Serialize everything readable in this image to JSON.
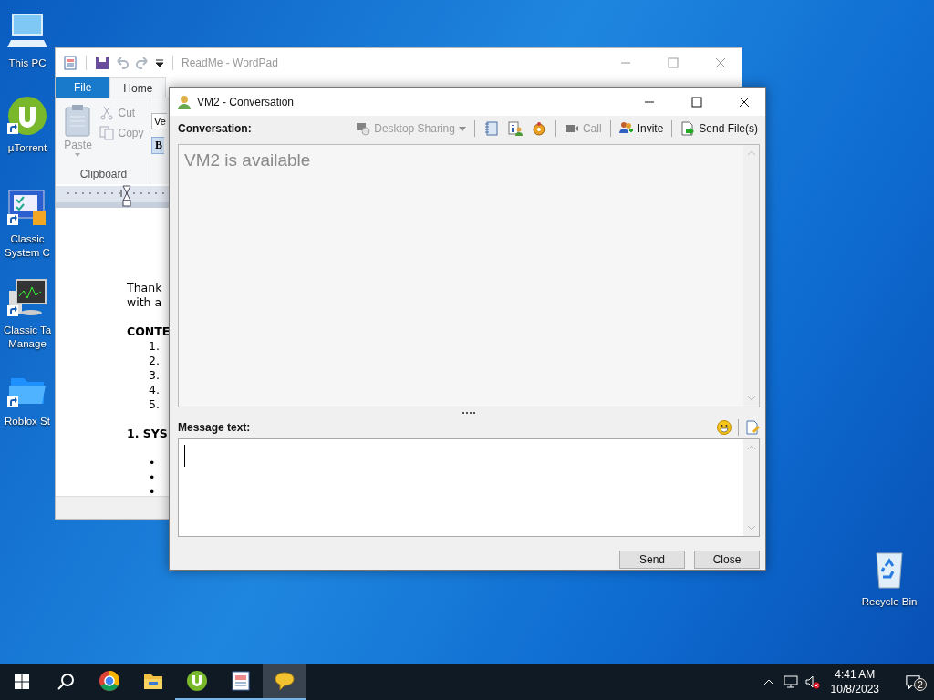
{
  "desktop": {
    "icons": [
      {
        "lines": [
          "This PC"
        ]
      },
      {
        "lines": [
          "µTorrent"
        ]
      },
      {
        "lines": [
          "Classic",
          "System C"
        ]
      },
      {
        "lines": [
          "Classic Ta",
          "Manage"
        ]
      },
      {
        "lines": [
          "Roblox St"
        ]
      }
    ],
    "recycle_bin": {
      "lines": [
        "Recycle Bin"
      ]
    }
  },
  "wordpad": {
    "title": "ReadMe - WordPad",
    "active": false,
    "tabs": [
      {
        "label": "File",
        "kind": "file",
        "selected": false
      },
      {
        "label": "Home",
        "kind": "tab",
        "selected": true
      }
    ],
    "clipboard": {
      "paste": "Paste",
      "cut": "Cut",
      "copy": "Copy",
      "disabled": true,
      "group": "Clipboard"
    },
    "font_field": "Ve",
    "bold_button": "B",
    "lines": [
      {
        "kind": "text",
        "text": "Thank"
      },
      {
        "kind": "text",
        "text": "with a"
      },
      {
        "kind": "blank"
      },
      {
        "kind": "heading",
        "text": "CONTE"
      },
      {
        "kind": "item",
        "text": "1."
      },
      {
        "kind": "item",
        "text": "2."
      },
      {
        "kind": "item",
        "text": "3."
      },
      {
        "kind": "item",
        "text": "4."
      },
      {
        "kind": "item",
        "text": "5."
      },
      {
        "kind": "blank"
      },
      {
        "kind": "heading",
        "text": "1. SYS"
      },
      {
        "kind": "blank"
      },
      {
        "kind": "item",
        "text": "•"
      },
      {
        "kind": "item",
        "text": "•"
      },
      {
        "kind": "item",
        "text": "•"
      }
    ]
  },
  "conversation": {
    "title": "VM2 - Conversation",
    "active": true,
    "label": "Conversation:",
    "toolbar": [
      {
        "kind": "labeled",
        "label": "Desktop Sharing",
        "disabled": true,
        "dropdown": true
      },
      {
        "kind": "separator"
      },
      {
        "kind": "icon"
      },
      {
        "kind": "icon"
      },
      {
        "kind": "icon"
      },
      {
        "kind": "separator"
      },
      {
        "kind": "labeled",
        "label": "Call",
        "disabled": true,
        "dropdown": false
      },
      {
        "kind": "separator"
      },
      {
        "kind": "labeled",
        "label": "Invite",
        "disabled": false,
        "dropdown": false
      },
      {
        "kind": "separator"
      },
      {
        "kind": "labeled",
        "label": "Send File(s)",
        "disabled": false,
        "dropdown": false
      }
    ],
    "status_text": "VM2 is available",
    "message_label": "Message text:",
    "buttons": [
      "Send",
      "Close"
    ]
  },
  "taskbar": {
    "apps": [
      {
        "running": false,
        "selected": false
      },
      {
        "running": false,
        "selected": false
      },
      {
        "running": true,
        "selected": false
      },
      {
        "running": true,
        "selected": false
      },
      {
        "running": true,
        "selected": true
      }
    ],
    "time": "4:41 AM",
    "date": "10/8/2023",
    "notifications": "2"
  }
}
